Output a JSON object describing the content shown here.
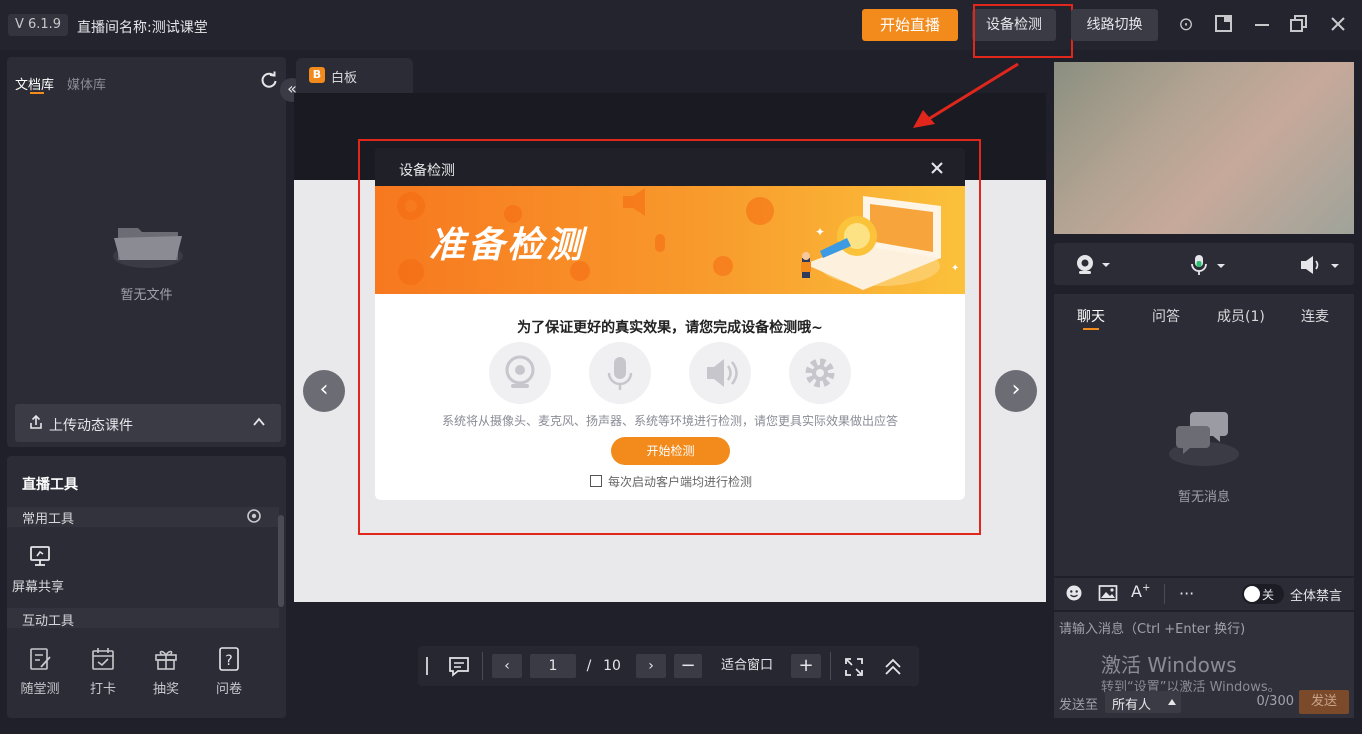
{
  "app": {
    "version": "V 6.1.9",
    "title": "直播间名称:测试课堂"
  },
  "topbar": {
    "start_live": "开始直播",
    "device_check": "设备检测",
    "line_switch": "线路切换",
    "icons": [
      "camera-record-icon",
      "popout-icon",
      "minimize-icon",
      "restore-icon",
      "close-icon"
    ]
  },
  "left": {
    "tabs": [
      "文档库",
      "媒体库"
    ],
    "empty_text": "暂无文件",
    "upload_label": "上传动态课件"
  },
  "tools": {
    "title": "直播工具",
    "common_title": "常用工具",
    "screen_share": "屏幕共享",
    "interactive_title": "互动工具",
    "items": [
      "随堂测",
      "打卡",
      "抽奖",
      "问卷"
    ]
  },
  "whiteboard": {
    "tab_label": "白板",
    "tab_badge": "B"
  },
  "dialog": {
    "title": "设备检测",
    "banner_title": "准备检测",
    "headline": "为了保证更好的真实效果，请您完成设备检测哦~",
    "description": "系统将从摄像头、麦克风、扬声器、系统等环境进行检测，请您更具实际效果做出应答",
    "start_button": "开始检测",
    "auto_check_label": "每次启动客户端均进行检测",
    "auto_check_checked": false
  },
  "pager": {
    "current_page": "1",
    "separator": "/",
    "total_pages": "10",
    "fit_label": "适合窗口"
  },
  "chat": {
    "tabs": [
      "聊天",
      "问答",
      "成员(1)",
      "连麦"
    ],
    "empty_text": "暂无消息",
    "mute_toggle_label": "关",
    "mute_all_label": "全体禁言",
    "input_placeholder": "请输入消息（Ctrl +Enter 换行)",
    "send_to_label": "发送至",
    "send_to_value": "所有人",
    "char_count": "0/300",
    "send_button": "发送"
  },
  "watermark": {
    "line1": "激活 Windows",
    "line2": "转到“设置”以激活 Windows。"
  },
  "colors": {
    "accent": "#f28a1c",
    "annotation_red": "#e1261c",
    "background": "#1f2029",
    "panel": "#2b2c36"
  }
}
